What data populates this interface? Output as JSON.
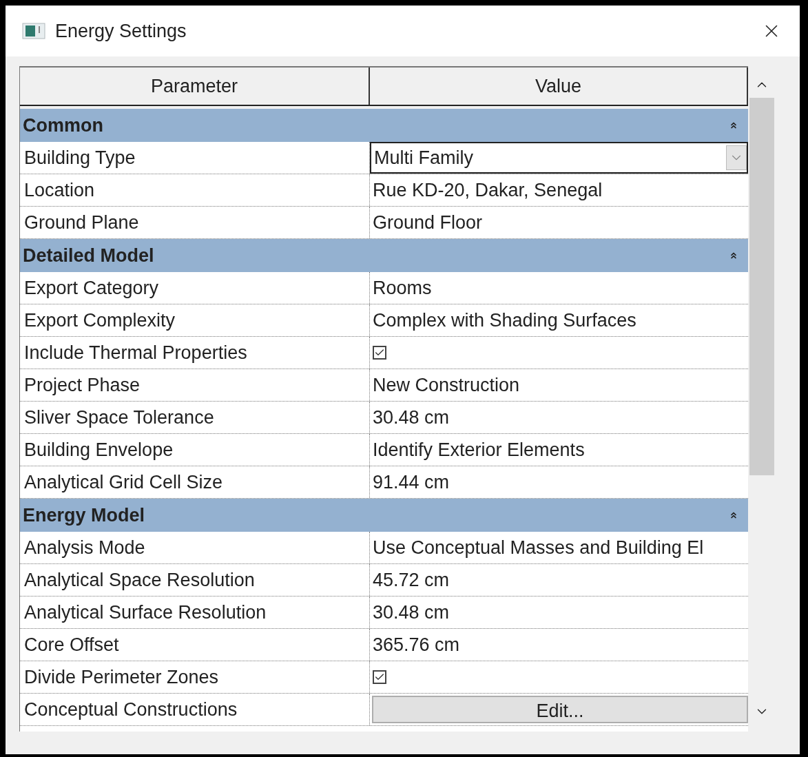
{
  "window": {
    "title": "Energy Settings"
  },
  "table": {
    "columns": [
      "Parameter",
      "Value"
    ],
    "groups": [
      {
        "name": "Common",
        "expanded": true,
        "rows": [
          {
            "parameter": "Building Type",
            "kind": "dropdown",
            "value": "Multi Family"
          },
          {
            "parameter": "Location",
            "kind": "text",
            "value": "Rue KD-20, Dakar, Senegal"
          },
          {
            "parameter": "Ground Plane",
            "kind": "text",
            "value": "Ground Floor"
          }
        ]
      },
      {
        "name": "Detailed Model",
        "expanded": true,
        "rows": [
          {
            "parameter": "Export Category",
            "kind": "text",
            "value": "Rooms"
          },
          {
            "parameter": "Export Complexity",
            "kind": "text",
            "value": "Complex with Shading Surfaces"
          },
          {
            "parameter": "Include Thermal Properties",
            "kind": "checkbox",
            "checked": true
          },
          {
            "parameter": "Project Phase",
            "kind": "text",
            "value": "New Construction"
          },
          {
            "parameter": "Sliver Space Tolerance",
            "kind": "text",
            "value": "30.48 cm"
          },
          {
            "parameter": "Building Envelope",
            "kind": "text",
            "value": "Identify Exterior Elements"
          },
          {
            "parameter": "Analytical Grid Cell Size",
            "kind": "text",
            "value": "91.44 cm"
          }
        ]
      },
      {
        "name": "Energy Model",
        "expanded": true,
        "rows": [
          {
            "parameter": "Analysis Mode",
            "kind": "text",
            "value": "Use Conceptual Masses and Building El"
          },
          {
            "parameter": "Analytical Space Resolution",
            "kind": "text",
            "value": "45.72 cm"
          },
          {
            "parameter": "Analytical Surface Resolution",
            "kind": "text",
            "value": "30.48 cm"
          },
          {
            "parameter": "Core Offset",
            "kind": "text",
            "value": "365.76 cm"
          },
          {
            "parameter": "Divide Perimeter Zones",
            "kind": "checkbox",
            "checked": true
          },
          {
            "parameter": "Conceptual Constructions",
            "kind": "button",
            "value": "Edit..."
          }
        ]
      }
    ]
  }
}
